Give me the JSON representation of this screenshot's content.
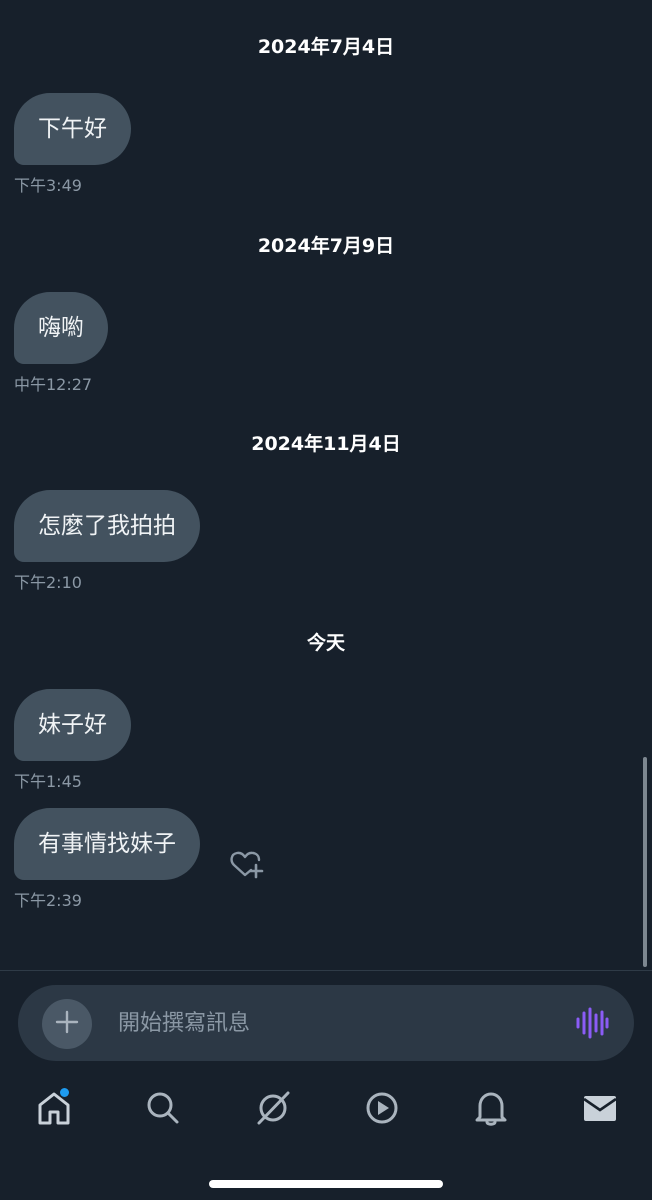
{
  "messages": [
    {
      "date": "2024年7月4日",
      "text": "下午好",
      "time": "下午3:49"
    },
    {
      "date": "2024年7月9日",
      "text": "嗨喲",
      "time": "中午12:27"
    },
    {
      "date": "2024年11月4日",
      "text": "怎麼了我拍拍",
      "time": "下午2:10"
    },
    {
      "date": "今天",
      "text": "妹子好",
      "time": "下午1:45"
    },
    {
      "text": "有事情找妹子",
      "time": "下午2:39"
    }
  ],
  "composer": {
    "placeholder": "開始撰寫訊息"
  },
  "icons": {
    "react": "heart-plus-icon",
    "add": "plus-icon",
    "voice": "voice-waveform-icon",
    "nav": [
      "home-icon",
      "search-icon",
      "grok-icon",
      "play-icon",
      "bell-icon",
      "mail-icon"
    ]
  },
  "colors": {
    "background": "#17202b",
    "bubble": "#43525f",
    "accent_voice": "#8b5cf6",
    "badge": "#1d9bf0"
  }
}
